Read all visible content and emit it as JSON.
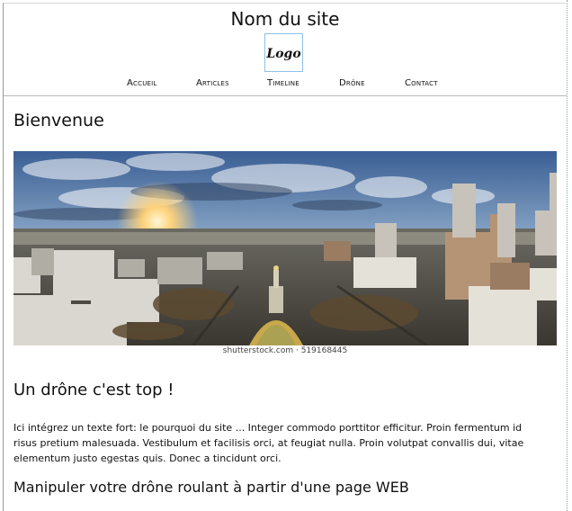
{
  "header": {
    "site_title": "Nom du site",
    "logo_text": "Logo"
  },
  "nav": {
    "items": [
      {
        "label": "Accueil"
      },
      {
        "label": "Articles"
      },
      {
        "label": "Timeline"
      },
      {
        "label": "Drône"
      },
      {
        "label": "Contact"
      }
    ]
  },
  "main": {
    "heading": "Bienvenue",
    "image_caption": "shutterstock.com · 519168445",
    "section_title": "Un drône c'est top !",
    "intro_text": "Ici intégrez un texte fort: le pourquoi du site ... Integer commodo porttitor efficitur. Proin fermentum id risus pretium malesuada. Vestibulum et facilisis orci, at feugiat nulla. Proin volutpat convallis dui, vitae elementum justo egestas quis. Donec a tincidunt orci.",
    "subsection_title": "Manipuler votre drône roulant à partir d'une page WEB"
  },
  "colors": {
    "logo_border": "#8fc0e6",
    "separator": "#b9b9b9",
    "sky_top": "#3b5f95",
    "sun": "#ffd27a"
  }
}
